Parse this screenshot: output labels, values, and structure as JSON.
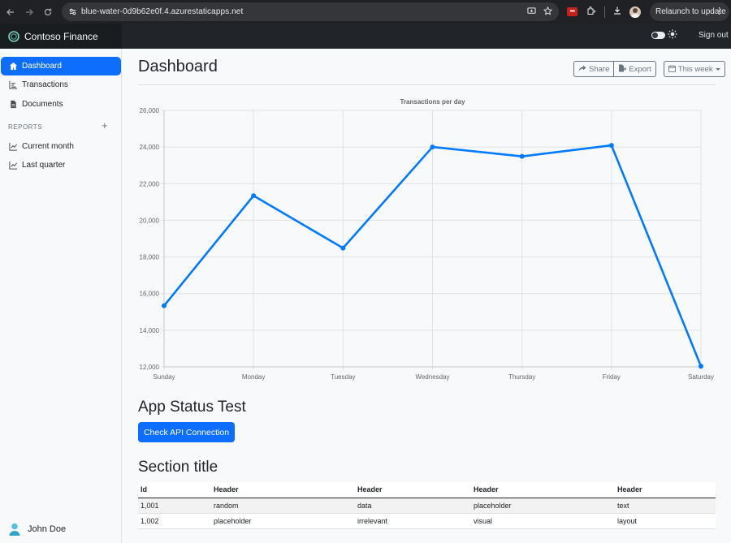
{
  "browser": {
    "url": "blue-water-0d9b62e0f.4.azurestaticapps.net",
    "relaunch_label": "Relaunch to update"
  },
  "app": {
    "brand": "Contoso Finance",
    "sign_out": "Sign out"
  },
  "sidebar": {
    "items": [
      {
        "label": "Dashboard",
        "icon": "home-icon",
        "active": true
      },
      {
        "label": "Transactions",
        "icon": "bar-chart-icon"
      },
      {
        "label": "Documents",
        "icon": "file-icon"
      }
    ],
    "reports_heading": "REPORTS",
    "reports": [
      {
        "label": "Current month",
        "icon": "line-chart-icon"
      },
      {
        "label": "Last quarter",
        "icon": "line-chart-icon"
      }
    ],
    "user": "John Doe"
  },
  "main": {
    "title": "Dashboard",
    "toolbar": {
      "share": "Share",
      "export": "Export",
      "range": "This week"
    },
    "status_title": "App Status Test",
    "api_button": "Check API Connection",
    "section_title": "Section title"
  },
  "table": {
    "headers": [
      "Id",
      "Header",
      "Header",
      "Header",
      "Header"
    ],
    "rows": [
      [
        "1,001",
        "random",
        "data",
        "placeholder",
        "text"
      ],
      [
        "1,002",
        "placeholder",
        "irrelevant",
        "visual",
        "layout"
      ]
    ]
  },
  "chart_data": {
    "type": "line",
    "title": "Transactions per day",
    "categories": [
      "Sunday",
      "Monday",
      "Tuesday",
      "Wednesday",
      "Thursday",
      "Friday",
      "Saturday"
    ],
    "series": [
      {
        "values": [
          15339,
          21345,
          18483,
          24003,
          23489,
          24092,
          12034
        ],
        "color": "#007bff"
      }
    ],
    "ylim": [
      12000,
      26000
    ],
    "yticks": [
      "12,000",
      "14,000",
      "16,000",
      "18,000",
      "20,000",
      "22,000",
      "24,000",
      "26,000"
    ],
    "grid": true,
    "legend": false
  }
}
